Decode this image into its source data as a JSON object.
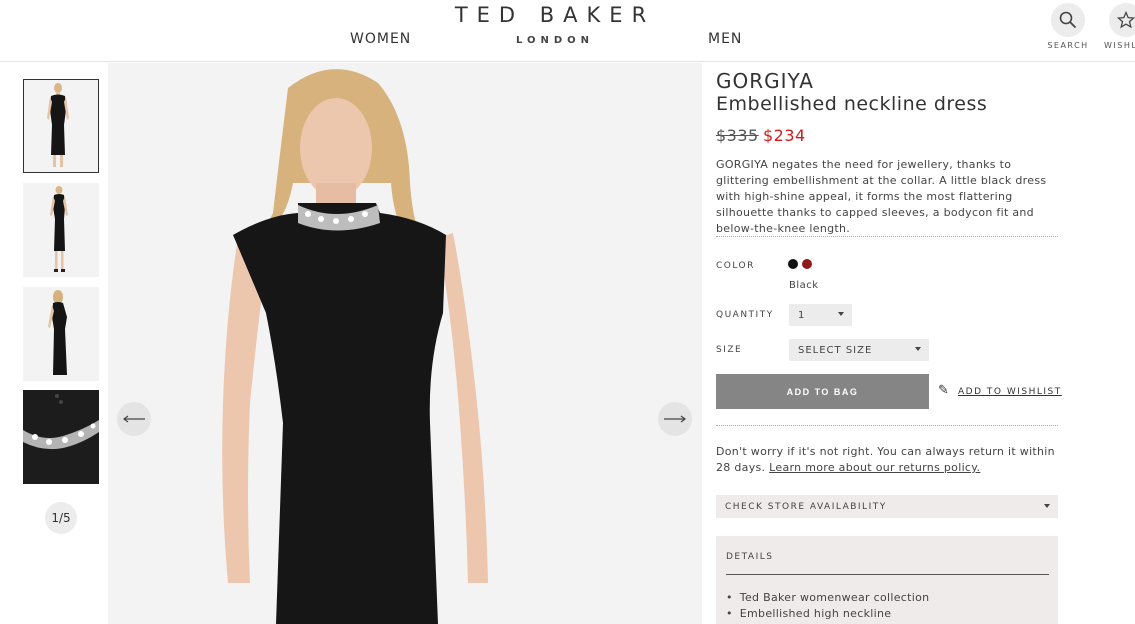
{
  "header": {
    "brand": "TED BAKER",
    "brand_sub": "LONDON",
    "nav": {
      "women": "WOMEN",
      "men": "MEN"
    },
    "search_label": "SEARCH",
    "wishlist_label": "WISHLIST",
    "icons": {
      "search": "search-icon",
      "wishlist": "star-icon"
    }
  },
  "gallery": {
    "pager": "1/5",
    "thumbnails": [
      "front view",
      "full length front",
      "back view",
      "neckline detail"
    ],
    "active_index": 0
  },
  "product": {
    "name": "GORGIYA",
    "subtitle": "Embellished neckline dress",
    "price_old": "$335",
    "price_new": "$234",
    "description": "GORGIYA negates the need for jewellery, thanks to glittering embellishment at the collar. A little black dress with high-shine appeal, it forms the most flattering silhouette thanks to capped sleeves, a bodycon fit and below-the-knee length.",
    "color_label": "COLOR",
    "colors": [
      {
        "name": "Black",
        "hex": "#111111"
      },
      {
        "name": "Red",
        "hex": "#8e1a1a"
      }
    ],
    "selected_color": "Black",
    "quantity_label": "QUANTITY",
    "quantity_value": "1",
    "size_label": "SIZE",
    "size_value": "SELECT SIZE",
    "add_to_bag": "ADD TO BAG",
    "add_to_wishlist": "ADD TO WISHLIST",
    "returns_text": "Don't worry if it's not right. You can always return it within 28 days.",
    "returns_link": "Learn more about our returns policy.",
    "store_availability": "CHECK STORE AVAILABILITY",
    "details_title": "DETAILS",
    "details_items": [
      "Ted Baker womenwear collection",
      "Embellished high neckline"
    ]
  },
  "colors": {
    "sale_red": "#d01c1c",
    "button_grey": "#858585",
    "panel_beige": "#eeebea"
  }
}
